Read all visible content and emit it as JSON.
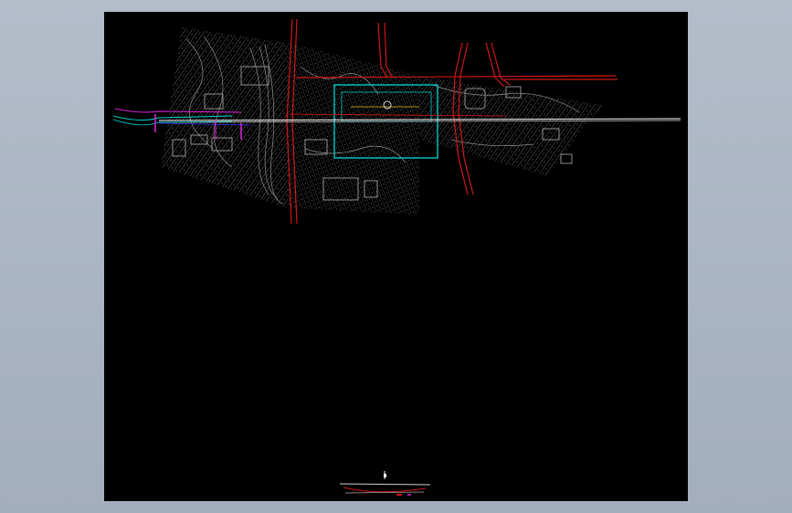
{
  "viewer": {
    "background_color": "#a9b4c2",
    "canvas_color": "#000000"
  },
  "drawing": {
    "layer_colors": {
      "terrain": "#9a9a9a",
      "roads_red": "#d01818",
      "alignment_white": "#ffffff",
      "station_box": "#00c8c8",
      "alignment_cyan": "#00d0d0",
      "alignment_magenta": "#e020e0",
      "alignment_blue": "#3030ff",
      "accent_yellow": "#e0c020"
    },
    "main_plan": "station-plan-drawing",
    "profile_strip": "longitudinal-profile-strip"
  }
}
